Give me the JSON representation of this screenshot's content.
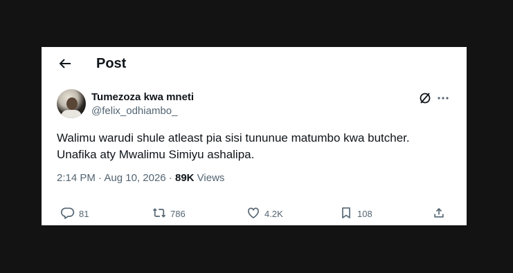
{
  "header": {
    "title": "Post"
  },
  "author": {
    "display_name": "Tumezoza kwa mneti",
    "handle": "@felix_odhiambo_"
  },
  "tweet": {
    "lines": [
      "Walimu warudi shule atleast pia sisi tununue matumbo kwa butcher.",
      "Unafika aty Mwalimu Simiyu ashalipa."
    ]
  },
  "meta": {
    "time": "2:14 PM",
    "separator": " · ",
    "date": "Aug 10, 2026",
    "separator2": " · ",
    "views_count": "89K",
    "views_label": " Views"
  },
  "actions": {
    "replies": "81",
    "reposts": "786",
    "likes": "4.2K",
    "bookmarks": "108"
  },
  "icons": [
    "arrow-left-icon",
    "grok-icon",
    "more-icon",
    "reply-icon",
    "repost-icon",
    "like-icon",
    "bookmark-icon",
    "share-icon"
  ]
}
